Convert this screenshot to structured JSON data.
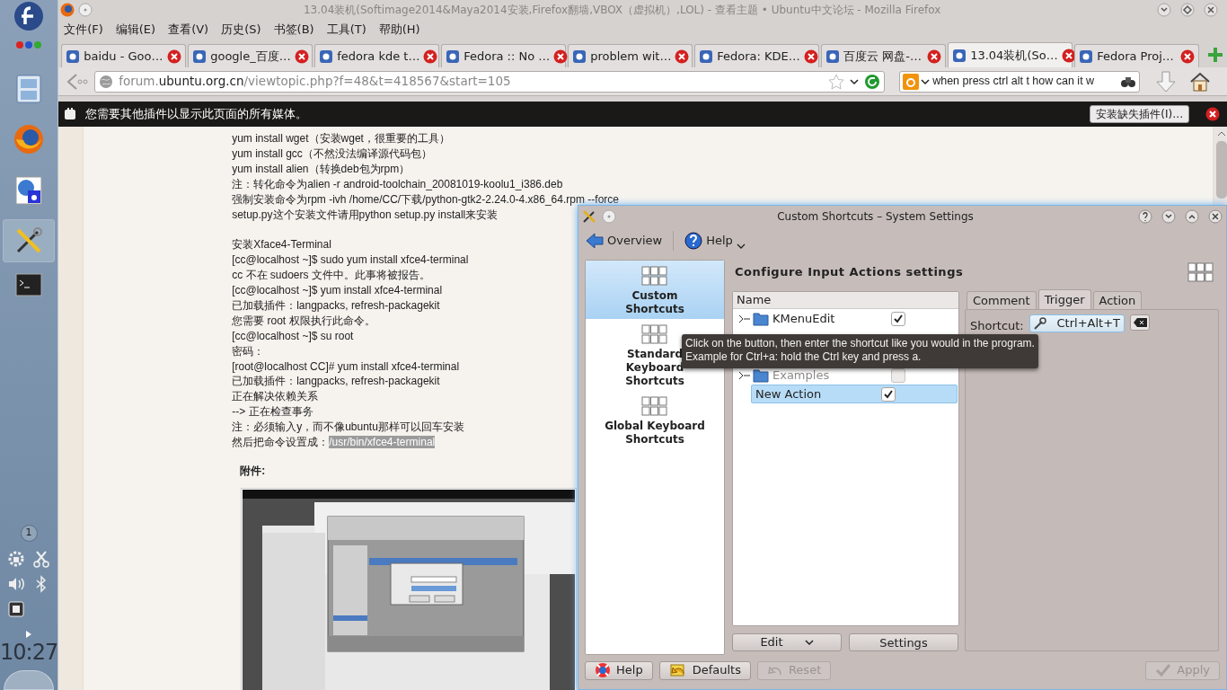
{
  "panel": {
    "notifications": "1",
    "clock": "10:27"
  },
  "browser": {
    "title": "13.04装机(Softimage2014&Maya2014安装,Firefox翻墙,VBOX（虚拟机）,LOL) - 查看主题 • Ubuntu中文论坛 - Mozilla Firefox",
    "menu": [
      "文件(F)",
      "编辑(E)",
      "查看(V)",
      "历史(S)",
      "书签(B)",
      "工具(T)",
      "帮助(H)"
    ],
    "tabs": [
      {
        "label": "baidu - Goo…",
        "selected": false
      },
      {
        "label": "google_百度…",
        "selected": false
      },
      {
        "label": "fedora kde t…",
        "selected": false
      },
      {
        "label": "Fedora :: No …",
        "selected": false
      },
      {
        "label": "problem wit…",
        "selected": false
      },
      {
        "label": "Fedora: KDE…",
        "selected": false
      },
      {
        "label": "百度云 网盘-…",
        "selected": false
      },
      {
        "label": "13.04装机(So…",
        "selected": true
      },
      {
        "label": "Fedora Proj…",
        "selected": false
      }
    ],
    "url": {
      "prefix": "forum.",
      "host": "ubuntu.org.cn",
      "path": "/viewtopic.php?f=48&t=418567&start=105"
    },
    "search": {
      "value": "when press ctrl alt t how can it w"
    },
    "plugin_bar": {
      "message": "您需要其他插件以显示此页面的所有媒体。",
      "button": "安装缺失插件(I)…"
    }
  },
  "post": {
    "paragraphs": [
      [
        "yum install wget（安装wget，很重要的工具）",
        "yum install gcc（不然没法编译源代码包）",
        "yum install alien（转换deb包为rpm）",
        "注：转化命令为alien -r android-toolchain_20081019-koolu1_i386.deb",
        "强制安装命令为rpm -ivh /home/CC/下载/python-gtk2-2.24.0-4.x86_64.rpm --force",
        "setup.py这个安装文件请用python setup.py install来安装"
      ],
      [
        "安装Xface4-Terminal",
        "[cc@localhost ~]$ sudo yum install xfce4-terminal",
        "cc 不在 sudoers 文件中。此事将被报告。",
        "[cc@localhost ~]$ yum install xfce4-terminal",
        "已加载插件：langpacks, refresh-packagekit",
        "您需要 root 权限执行此命令。",
        "[cc@localhost ~]$ su root",
        "密码：",
        "[root@localhost CC]# yum install xfce4-terminal",
        "已加载插件：langpacks, refresh-packagekit",
        "正在解决依赖关系",
        "--> 正在检查事务",
        "注：必须输入y，而不像ubuntu那样可以回车安装"
      ]
    ],
    "last_line": {
      "text": "然后把命令设置成：",
      "selection": "/usr/bin/xfce4-terminal"
    },
    "attachment_label": "附件:"
  },
  "dialog": {
    "title": "Custom Shortcuts – System Settings",
    "toolbar": [
      "Overview",
      "Help"
    ],
    "categories": [
      {
        "label": "Custom Shortcuts",
        "selected": true
      },
      {
        "label": "Standard Keyboard Shortcuts",
        "selected": false
      },
      {
        "label": "Global Keyboard Shortcuts",
        "selected": false
      }
    ],
    "heading": "Configure Input Actions settings",
    "tree": {
      "column": "Name",
      "rows": [
        {
          "kind": "group",
          "label": "KMenuEdit",
          "checked": true,
          "disabled": false,
          "selected": false
        },
        {
          "kind": "group",
          "label": "Examples",
          "checked": false,
          "disabled": true,
          "selected": false
        },
        {
          "kind": "action",
          "label": "New Action",
          "checked": true,
          "disabled": false,
          "selected": true
        }
      ]
    },
    "tabs": [
      {
        "label": "Comment",
        "selected": false
      },
      {
        "label": "Trigger",
        "selected": true
      },
      {
        "label": "Action",
        "selected": false
      }
    ],
    "shortcut": {
      "label": "Shortcut:",
      "value": "Ctrl+Alt+T"
    },
    "tooltip": [
      "Click on the button, then enter the shortcut like you would in the program.",
      "Example for Ctrl+a: hold the Ctrl key and press a."
    ],
    "list_buttons": [
      "Edit",
      "Settings"
    ],
    "footer": [
      {
        "kind": "help",
        "label": "Help",
        "disabled": false
      },
      {
        "kind": "defaults",
        "label": "Defaults",
        "disabled": false
      },
      {
        "kind": "reset",
        "label": "Reset",
        "disabled": true
      },
      {
        "kind": "apply",
        "label": "Apply",
        "disabled": true
      }
    ]
  }
}
